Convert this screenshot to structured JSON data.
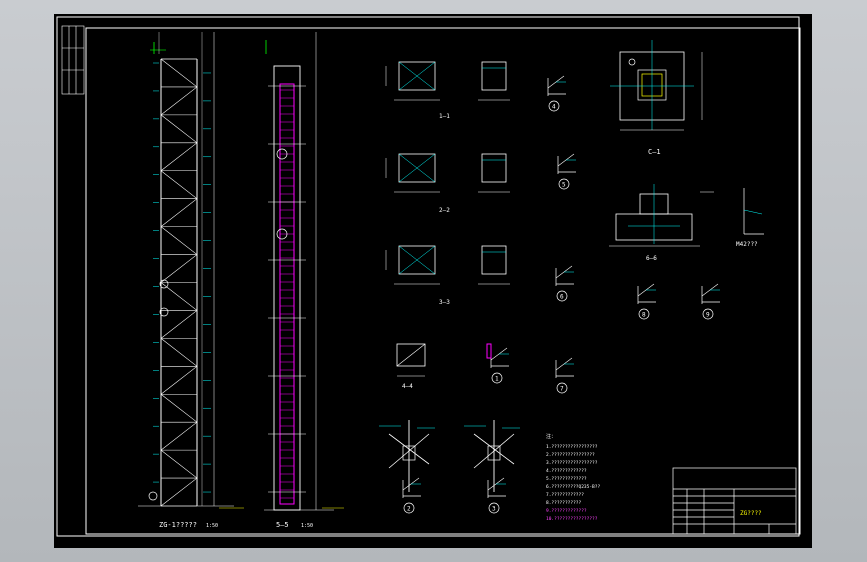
{
  "drawing": {
    "elevation_title": "ZG-1?????",
    "elevation_scale": "1:50",
    "side_section_label": "5—5",
    "side_section_scale": "1:50",
    "section_1_label": "1—1",
    "section_2_label": "2—2",
    "section_3_label": "3—3",
    "section_4_label": "4—4",
    "plan_c_label": "C—1",
    "plan_6_label": "6—6",
    "detail_ids": [
      "1",
      "2",
      "3",
      "4",
      "5",
      "6",
      "7",
      "8",
      "9"
    ],
    "steel_label": "M42???",
    "note_header": "注：",
    "notes": [
      "1.?????????????????",
      "2.????????????????",
      "3.?????????????????",
      "4.?????????????",
      "5.?????????????",
      "6.??????????Q235-B??",
      "7.????????????",
      "8.???????????",
      "9.?????????????",
      "10.????????????????"
    ],
    "titleblock_text": "ZG????",
    "colors": {
      "lines": "#ffffff",
      "members": "#ff00ff",
      "dims": "#00ffff",
      "axis": "#00ff00",
      "accent": "#ffff00"
    }
  }
}
